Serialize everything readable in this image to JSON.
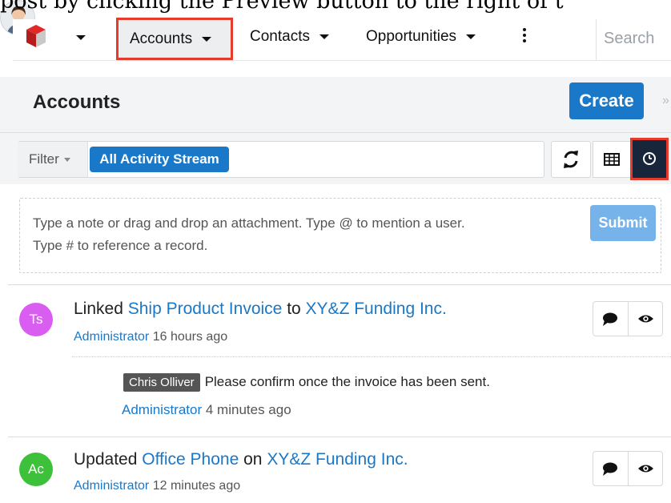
{
  "caption": "post by clicking the Preview button to the right of t",
  "topnav": {
    "tabs": [
      {
        "label": "Accounts"
      },
      {
        "label": "Contacts"
      },
      {
        "label": "Opportunities"
      }
    ],
    "search_placeholder": "Search"
  },
  "header": {
    "title": "Accounts",
    "create_label": "Create"
  },
  "filter": {
    "label": "Filter",
    "active_filter": "All Activity Stream"
  },
  "note": {
    "line1": "Type a note or drag and drop an attachment. Type @ to mention a user.",
    "line2": "Type # to reference a record.",
    "submit_label": "Submit"
  },
  "activities": [
    {
      "initials": "Ts",
      "avatar_color": "#da5df2",
      "action": "Linked",
      "record": "Ship Product Invoice",
      "connector": "to",
      "target": "XY&Z Funding Inc.",
      "user": "Administrator",
      "time": "16 hours ago",
      "comment": {
        "tag": "Chris Olliver",
        "text": "Please confirm once the invoice has been sent.",
        "user": "Administrator",
        "time": "4 minutes ago"
      }
    },
    {
      "initials": "Ac",
      "avatar_color": "#3ec13a",
      "action": "Updated",
      "record": "Office Phone",
      "connector": "on",
      "target": "XY&Z Funding Inc.",
      "user": "Administrator",
      "time": "12 minutes ago"
    }
  ],
  "colors": {
    "primary": "#1a78c8",
    "highlight_border": "#e53b2c",
    "submit_disabled": "#75b3ea",
    "active_toggle": "#17263a"
  }
}
